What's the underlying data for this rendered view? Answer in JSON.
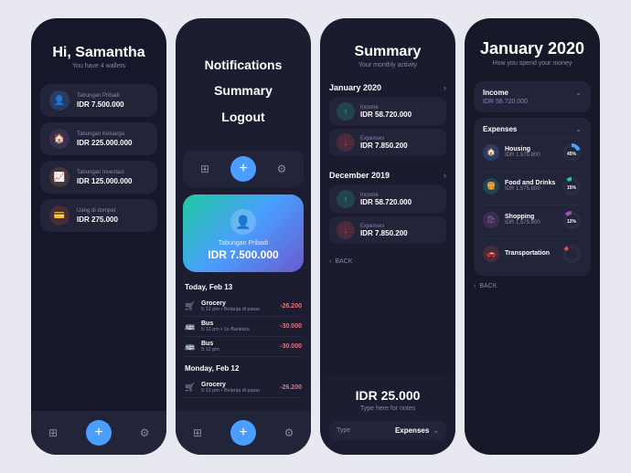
{
  "phone1": {
    "greeting": "Hi, Samantha",
    "subtitle": "You have 4 wallets",
    "wallets": [
      {
        "name": "Tabungan Pribadi",
        "amount": "IDR 7.500.000",
        "color": "#4a9eff",
        "icon": "👤"
      },
      {
        "name": "Tabungan Keluarga",
        "amount": "IDR 225.000.000",
        "color": "#9b59b6",
        "icon": "🏠"
      },
      {
        "name": "Tabungan Investasi",
        "amount": "IDR 125.000.000",
        "color": "#e67e22",
        "icon": "📈"
      },
      {
        "name": "Uang di dompet",
        "amount": "IDR 275.000",
        "color": "#e74c3c",
        "icon": "💳"
      }
    ],
    "bottom_bar": {
      "add_label": "+"
    }
  },
  "phone2": {
    "menu_items": [
      "Notifications",
      "Summary",
      "Logout"
    ],
    "card": {
      "name": "Tabungan Pribadi",
      "amount": "IDR 7.500.000"
    },
    "today_header": "Today, Feb 13",
    "transactions_today": [
      {
        "icon": "🛒",
        "name": "Grocery",
        "detail": "5:12 pm • Belanja di pasar",
        "amount": "-26.200"
      },
      {
        "icon": "🚌",
        "name": "Bus",
        "detail": "5:12 pm • 1x Bankara",
        "amount": "-30.000"
      },
      {
        "icon": "🚌",
        "name": "Bus",
        "detail": "5:12 pm",
        "amount": "-30.000"
      }
    ],
    "monday_header": "Monday, Feb 12",
    "transactions_monday": [
      {
        "icon": "🛒",
        "name": "Grocery",
        "detail": "5:12 pm • Belanja di pasar",
        "amount": "-26.200"
      }
    ]
  },
  "phone3": {
    "title": "Summary",
    "subtitle": "Your monthly activity",
    "sections": [
      {
        "month": "January 2020",
        "entries": [
          {
            "type": "Income",
            "amount": "IDR 58.720.000",
            "color": "#20c9a0",
            "icon": "↑"
          },
          {
            "type": "Expenses",
            "amount": "IDR 7.850.200",
            "color": "#e74c3c",
            "icon": "↓"
          }
        ]
      },
      {
        "month": "December 2019",
        "entries": [
          {
            "type": "Income",
            "amount": "IDR 58.720.000",
            "color": "#20c9a0",
            "icon": "↑"
          },
          {
            "type": "Expenses",
            "amount": "IDR 7.850.200",
            "color": "#e74c3c",
            "icon": "↓"
          }
        ]
      }
    ],
    "back_label": "BACK",
    "note_amount": "IDR 25.000",
    "note_placeholder": "Type here for notes",
    "type_label": "Type",
    "type_value": "Expenses"
  },
  "phone4": {
    "title": "January 2020",
    "subtitle": "How you spend your money",
    "income_label": "Income",
    "income_value": "IDR 58.720.000",
    "expenses_label": "Expenses",
    "expense_items": [
      {
        "name": "Housing",
        "amount": "IDR 1.575.800",
        "color": "#4a9eff",
        "pct": "45%",
        "icon": "🏠"
      },
      {
        "name": "Food and Drinks",
        "amount": "IDR 1.575.800",
        "color": "#20c9a0",
        "pct": "15%",
        "icon": "🍔"
      },
      {
        "name": "Shopping",
        "amount": "IDR 1.575.800",
        "color": "#9b59b6",
        "pct": "12%",
        "icon": "🛍"
      },
      {
        "name": "Transportation",
        "amount": "",
        "color": "#e74c3c",
        "pct": "",
        "icon": "🚗"
      }
    ],
    "back_label": "BACK"
  }
}
